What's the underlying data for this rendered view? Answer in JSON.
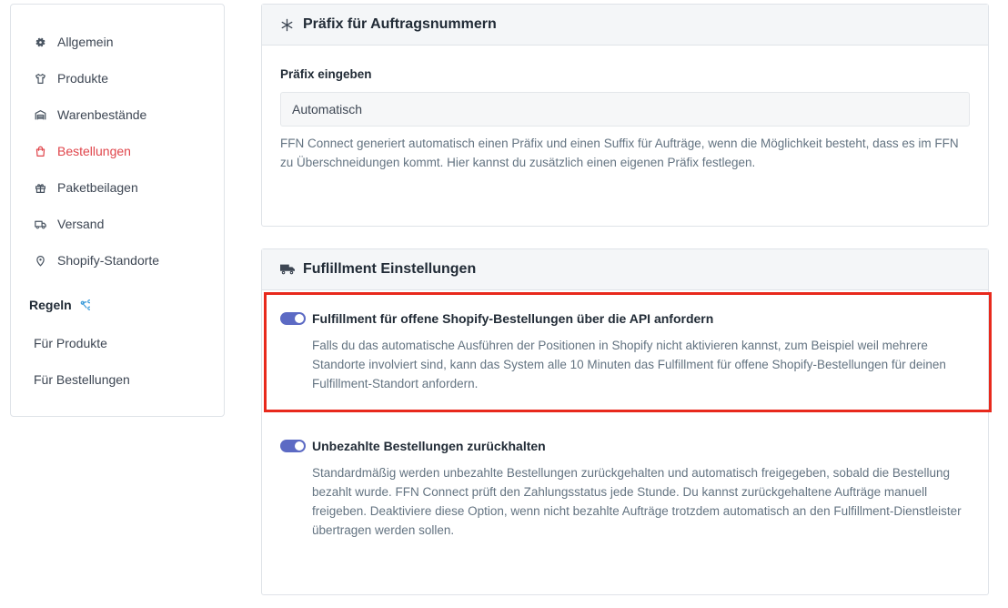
{
  "sidebar": {
    "items": [
      {
        "label": "Allgemein",
        "icon": "gear-icon"
      },
      {
        "label": "Produkte",
        "icon": "shirt-icon"
      },
      {
        "label": "Warenbestände",
        "icon": "warehouse-icon"
      },
      {
        "label": "Bestellungen",
        "icon": "shopping-bag-icon",
        "active": true
      },
      {
        "label": "Paketbeilagen",
        "icon": "gift-icon"
      },
      {
        "label": "Versand",
        "icon": "shipping-icon"
      },
      {
        "label": "Shopify-Standorte",
        "icon": "location-pin-icon"
      }
    ],
    "rules_title": "Regeln",
    "rules": [
      {
        "label": "Für Produkte"
      },
      {
        "label": "Für Bestellungen"
      }
    ]
  },
  "prefix_card": {
    "title": "Präfix für Auftragsnummern",
    "field_label": "Präfix eingeben",
    "input_value": "Automatisch",
    "help": "FFN Connect generiert automatisch einen Präfix und einen Suffix für Aufträge, wenn die Möglichkeit besteht, dass es im FFN zu Überschneidungen kommt. Hier kannst du zusätzlich einen eigenen Präfix festlegen."
  },
  "fulfillment_card": {
    "title": "Fuflillment Einstellungen",
    "toggles": [
      {
        "label": "Fulfillment für offene Shopify-Bestellungen über die API anfordern",
        "enabled": true,
        "description": "Falls du das automatische Ausführen der Positionen in Shopify nicht aktivieren kannst, zum Beispiel weil mehrere Standorte involviert sind, kann das System alle 10 Minuten das Fulfillment für offene Shopify-Bestellungen für deinen Fulfillment-Standort anfordern."
      },
      {
        "label": "Unbezahlte Bestellungen zurückhalten",
        "enabled": true,
        "description": "Standardmäßig werden unbezahlte Bestellungen zurückgehalten und automatisch freigegeben, sobald die Bestellung bezahlt wurde. FFN Connect prüft den Zahlungsstatus jede Stunde. Du kannst zurückgehaltene Aufträge manuell freigeben. Deaktiviere diese Option, wenn nicht bezahlte Aufträge trotzdem automatisch an den Fulfillment-Dienstleister übertragen werden sollen."
      }
    ]
  },
  "colors": {
    "accent": "#5c6ac4",
    "active_nav": "#e0454b",
    "highlight": "#e8291c"
  }
}
